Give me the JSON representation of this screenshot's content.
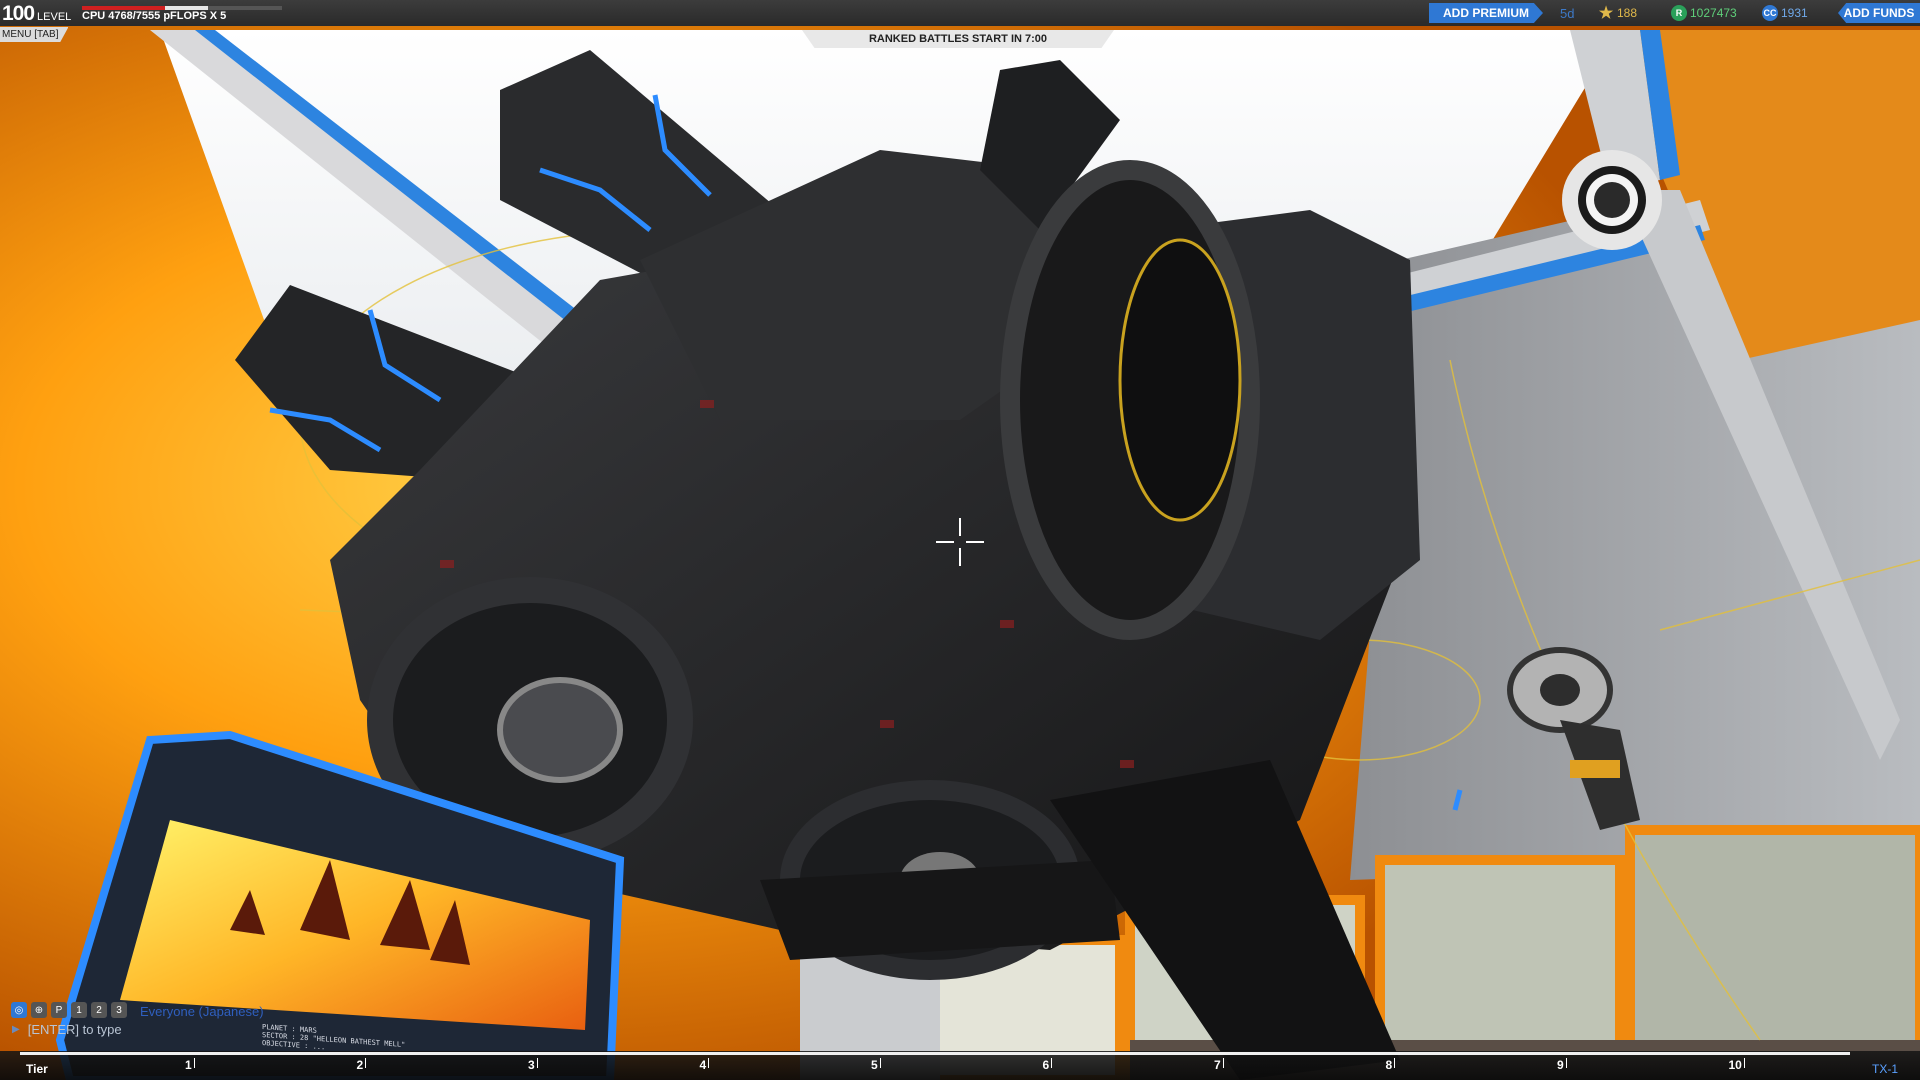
{
  "hud": {
    "level_value": "100",
    "level_label": "LEVEL",
    "cpu_text": "CPU 4768/7555 pFLOPS X 5",
    "cpu_used_fraction": 0.63,
    "menu_label": "MENU [TAB]",
    "ranked_banner": "RANKED BATTLES START IN 7:00",
    "add_premium_label": "ADD PREMIUM",
    "premium_days": "5d",
    "stars_value": "188",
    "robits_value": "1027473",
    "cosmetic_credits_value": "1931",
    "add_funds_label": "ADD FUNDS",
    "accent_color": "#2f78d4"
  },
  "chat": {
    "channel": "Everyone (Japanese)",
    "input_placeholder": "[ENTER] to type",
    "icons": [
      "globe-icon",
      "clan-icon",
      "party-icon",
      "player1-icon",
      "player2-icon",
      "player3-icon"
    ]
  },
  "tiers": {
    "label": "Tier",
    "ticks": [
      "1",
      "2",
      "3",
      "4",
      "5",
      "6",
      "7",
      "8",
      "9",
      "10"
    ],
    "end_label": "TX-1"
  },
  "screen": {
    "line1": "PLANET : MARS",
    "line2": "SECTOR : 28 \"HELLEON BATHEST MELL\"",
    "line3": "OBJECTIVE : ..."
  }
}
